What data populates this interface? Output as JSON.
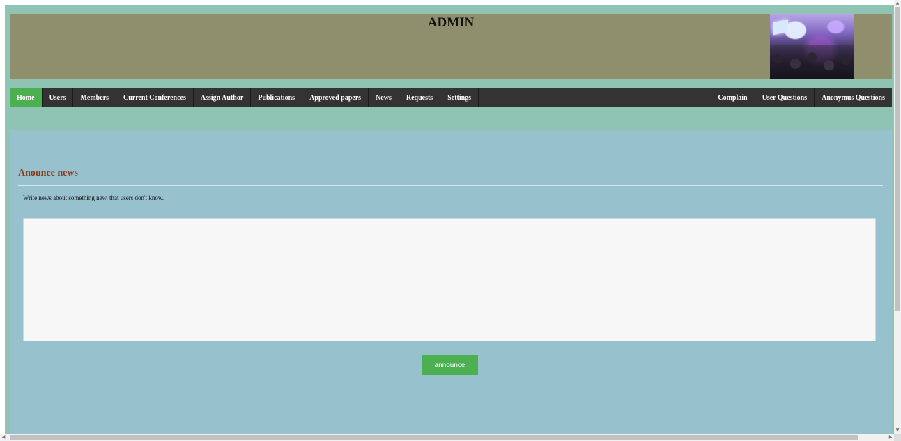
{
  "header": {
    "title": "ADMIN",
    "photo_icon": "conference-photo"
  },
  "nav": {
    "left_items": [
      {
        "label": "Home",
        "active": true
      },
      {
        "label": "Users"
      },
      {
        "label": "Members"
      },
      {
        "label": "Current Conferences"
      },
      {
        "label": "Assign Author"
      },
      {
        "label": "Publications"
      },
      {
        "label": "Approved papers"
      },
      {
        "label": "News"
      },
      {
        "label": "Requests"
      },
      {
        "label": "Settings"
      }
    ],
    "right_items": [
      {
        "label": "Complain"
      },
      {
        "label": "User Questions"
      },
      {
        "label": "Anonymus Questions"
      }
    ]
  },
  "news_form": {
    "heading": "Anounce news",
    "description": "Write news about something new, that users don't know.",
    "textarea_value": "",
    "textarea_placeholder": "",
    "submit_label": "announce"
  },
  "scrollbar_icons": {
    "up": "▲",
    "down": "▼",
    "left": "◀",
    "right": "▶"
  },
  "colors": {
    "page_bg": "#8fc4b5",
    "header_bg": "#8f8f6e",
    "nav_bg": "#333333",
    "nav_active": "#4caf50",
    "content_bg": "#98c1ce",
    "heading": "#8a3a1c",
    "button": "#4caf50"
  }
}
